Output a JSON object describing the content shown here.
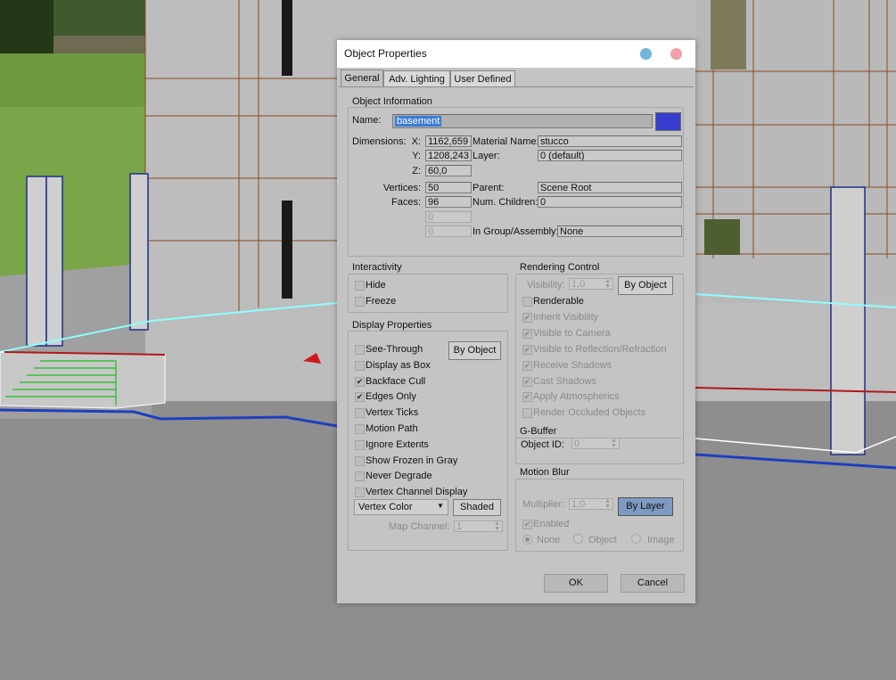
{
  "dialog": {
    "title": "Object Properties",
    "tabs": [
      "General",
      "Adv. Lighting",
      "User Defined"
    ]
  },
  "object_info": {
    "group_label": "Object Information",
    "name_label": "Name:",
    "name_value": "basement",
    "color_swatch": "#3a3ed0",
    "dimensions_label": "Dimensions:",
    "x_label": "X:",
    "x_value": "1162,659",
    "y_label": "Y:",
    "y_value": "1208,243",
    "z_label": "Z:",
    "z_value": "60,0",
    "material_label": "Material Name:",
    "material_value": "stucco",
    "layer_label": "Layer:",
    "layer_value": "0 (default)",
    "vertices_label": "Vertices:",
    "vertices_value": "50",
    "faces_label": "Faces:",
    "faces_value": "96",
    "blank1_value": "0",
    "blank2_value": "0",
    "parent_label": "Parent:",
    "parent_value": "Scene Root",
    "children_label": "Num. Children:",
    "children_value": "0",
    "group_assembly_label": "In Group/Assembly:",
    "group_assembly_value": "None"
  },
  "interactivity": {
    "group_label": "Interactivity",
    "hide": "Hide",
    "freeze": "Freeze"
  },
  "display": {
    "group_label": "Display Properties",
    "by_object": "By Object",
    "items": [
      {
        "label": "See-Through",
        "checked": false
      },
      {
        "label": "Display as Box",
        "checked": false
      },
      {
        "label": "Backface Cull",
        "checked": true
      },
      {
        "label": "Edges Only",
        "checked": true
      },
      {
        "label": "Vertex Ticks",
        "checked": false
      },
      {
        "label": "Motion Path",
        "checked": false
      },
      {
        "label": "Ignore Extents",
        "checked": false
      },
      {
        "label": "Show Frozen in Gray",
        "checked": false
      },
      {
        "label": "Never Degrade",
        "checked": false
      },
      {
        "label": "Vertex Channel Display",
        "checked": false
      }
    ],
    "vertex_color": "Vertex Color",
    "shaded": "Shaded",
    "map_channel_label": "Map Channel:",
    "map_channel_value": "1"
  },
  "rendering": {
    "group_label": "Rendering Control",
    "visibility_label": "Visibility:",
    "visibility_value": "1,0",
    "by_object": "By Object",
    "items": [
      {
        "label": "Renderable",
        "checked": false,
        "enabled": true
      },
      {
        "label": "Inherit Visibility",
        "checked": true,
        "enabled": false
      },
      {
        "label": "Visible to Camera",
        "checked": true,
        "enabled": false
      },
      {
        "label": "Visible to Reflection/Refraction",
        "checked": true,
        "enabled": false
      },
      {
        "label": "Receive Shadows",
        "checked": true,
        "enabled": false
      },
      {
        "label": "Cast Shadows",
        "checked": true,
        "enabled": false
      },
      {
        "label": "Apply Atmospherics",
        "checked": true,
        "enabled": false
      },
      {
        "label": "Render Occluded Objects",
        "checked": false,
        "enabled": false
      }
    ]
  },
  "gbuffer": {
    "group_label": "G-Buffer",
    "object_id_label": "Object ID:",
    "object_id_value": "0"
  },
  "motion_blur": {
    "group_label": "Motion Blur",
    "multiplier_label": "Multiplier:",
    "multiplier_value": "1,0",
    "by_layer": "By Layer",
    "enabled": "Enabled",
    "none": "None",
    "object": "Object",
    "image": "Image"
  },
  "footer": {
    "ok": "OK",
    "cancel": "Cancel"
  },
  "colors": {
    "accent_button": "#7f9ac2",
    "name_highlight": "#3a7bd5",
    "close_dot": "#f0a0a8",
    "min_dot": "#6fb7d8"
  }
}
